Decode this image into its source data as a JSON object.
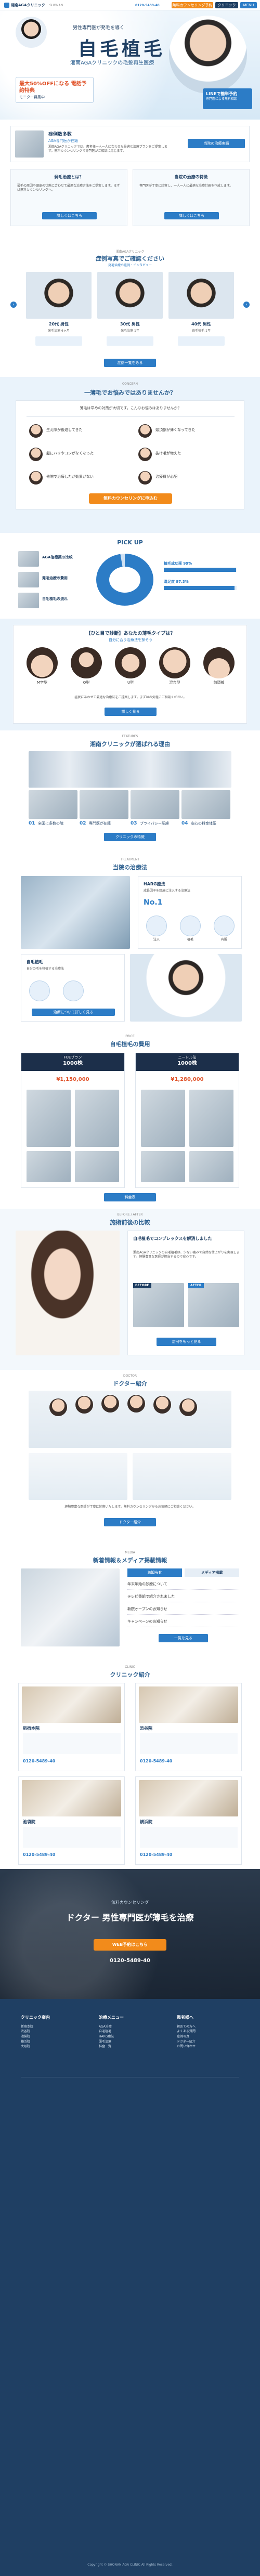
{
  "header": {
    "logo": "湘南AGAクリニック",
    "tag": "SHONAN",
    "tel": "0120-5489-40",
    "reserve": "無料カウンセリング予約",
    "clinic_btn": "クリニック",
    "menu": "MENU"
  },
  "hero": {
    "catch": "男性専門医が発毛を導く",
    "title": "自毛植毛",
    "sub": "湘南AGAクリニックの毛髪再生医療",
    "badge": "最大50%OFFになる 電話予約特典",
    "badge2": "モニター募集中",
    "side_banner": "LINEで簡単予約",
    "side_banner_sub": "専門医による無料相談"
  },
  "intro": {
    "doc_title": "症例数多数",
    "doc_sub": "AGA専門医が在籍",
    "para": "湘南AGAクリニックでは、患者様一人一人に合わせた最適な治療プランをご提案します。無料カウンセリングで専門医がご相談に応じます。",
    "left_btn": "当院の治療実績",
    "link_text": "詳しくはこちら",
    "boxes": [
      {
        "title": "発毛治療とは？",
        "text": "薄毛の原因や頭皮の状態に合わせて最適な治療方法をご提案します。まずは無料カウンセリングへ。"
      },
      {
        "title": "当院の治療の特徴",
        "text": "専門医が丁寧に診察し、一人一人に最適な治療計画を作成します。"
      }
    ]
  },
  "cases": {
    "kicker": "湘南AGAクリニック",
    "title": "症例写真でご確認ください",
    "subtitle": "発毛治療の症例・インタビュー",
    "items": [
      {
        "label": "20代 男性",
        "desc": "発毛治療 6ヶ月"
      },
      {
        "label": "30代 男性",
        "desc": "発毛治療 1年"
      },
      {
        "label": "40代 男性",
        "desc": "自毛植毛 1年"
      }
    ],
    "btn": "症例一覧をみる"
  },
  "concern": {
    "kicker": "CONCERN",
    "title": "一薄毛でお悩みではありませんか？",
    "lead": "薄毛は早めの対策が大切です。こんなお悩みはありませんか？",
    "notes": [
      "生え際が後退してきた",
      "頭頂部が薄くなってきた",
      "髪にハリやコシがなくなった",
      "抜け毛が増えた",
      "他院で治療したが効果がない",
      "治療費が心配"
    ],
    "cta": "無料カウンセリングに申込む"
  },
  "pickup": {
    "title": "PICK UP",
    "items": [
      "AGA治療薬の比較",
      "発毛治療の費用",
      "自毛植毛の流れ"
    ],
    "bars": [
      "植毛成功率 99%",
      "満足度 97.3%"
    ]
  },
  "types": {
    "title": "【ひと目で診断】あなたの薄毛タイプは？",
    "sub": "自分に合う治療法を探そう",
    "labels": [
      "M字型",
      "O型",
      "U型",
      "混合型",
      "前頭部"
    ],
    "note": "症状にあわせて最適な治療法をご提案します。まずはお気軽にご相談ください。",
    "btn": "詳しく見る"
  },
  "features": {
    "kicker": "FEATURES",
    "title": "湘南クリニックが選ばれる理由",
    "items": [
      {
        "n": "01",
        "t": "全国に多数の院"
      },
      {
        "n": "02",
        "t": "専門医が在籍"
      },
      {
        "n": "03",
        "t": "プライバシー配慮"
      },
      {
        "n": "04",
        "t": "安心の料金体系"
      }
    ],
    "btn": "クリニックの特徴"
  },
  "treat": {
    "kicker": "TREATMENT",
    "title": "当院の治療法",
    "boxes": [
      {
        "title": "HARG療法",
        "desc": "成長因子を頭皮に注入する治療法"
      },
      {
        "title": "自毛植毛",
        "desc": "自分の毛を移植する治療法"
      }
    ],
    "num": "No.1",
    "icons": [
      "注入",
      "植毛",
      "内服"
    ],
    "btn": "治療について詳しく見る"
  },
  "price": {
    "kicker": "PRICE",
    "title": "自毛植毛の費用",
    "plans": [
      {
        "name": "FUEプラン",
        "head": "1000株",
        "price": "¥1,150,000"
      },
      {
        "name": "ニードル法",
        "head": "1000株",
        "price": "¥1,280,000"
      }
    ],
    "btn": "料金表"
  },
  "ba": {
    "kicker": "BEFORE / AFTER",
    "title": "施術前後の比較",
    "quote": "自毛植毛でコンプレックスを解消しました",
    "lead": "湘南AGAクリニックの自毛植毛は、少ない痛みで自然な仕上がりを実現します。経験豊富な医師が担当するので安心です。",
    "ba_labels": [
      "BEFORE",
      "AFTER"
    ],
    "btn": "症例をもっと見る"
  },
  "doctors": {
    "kicker": "DOCTOR",
    "title": "ドクター紹介",
    "note": "経験豊富な医師が丁寧に診療いたします。無料カウンセリングからお気軽にご相談ください。",
    "btn": "ドクター紹介"
  },
  "media": {
    "kicker": "MEDIA",
    "title": "新着情報＆メディア掲載情報",
    "tabs": [
      "お知らせ",
      "メディア掲載"
    ],
    "items": [
      "年末年始の診療について",
      "テレビ番組で紹介されました",
      "新院オープンのお知らせ",
      "キャンペーンのお知らせ"
    ],
    "btn": "一覧を見る"
  },
  "clinics": {
    "kicker": "CLINIC",
    "title": "クリニック紹介",
    "list": [
      {
        "name": "新宿本院",
        "tel": "0120-5489-40"
      },
      {
        "name": "渋谷院",
        "tel": "0120-5489-40"
      },
      {
        "name": "池袋院",
        "tel": "0120-5489-40"
      },
      {
        "name": "横浜院",
        "tel": "0120-5489-40"
      }
    ]
  },
  "cta": {
    "kicker": "無料カウンセリング",
    "title": "ドクター 男性専門医が薄毛を治療",
    "btn": "WEB予約はこちら",
    "tel": "0120-5489-40"
  },
  "footer": {
    "cols": [
      {
        "head": "クリニック案内",
        "items": [
          "新宿本院",
          "渋谷院",
          "池袋院",
          "横浜院",
          "大阪院"
        ]
      },
      {
        "head": "治療メニュー",
        "items": [
          "AGA治療",
          "自毛植毛",
          "HARG療法",
          "薄毛治療",
          "料金一覧"
        ]
      },
      {
        "head": "患者様へ",
        "items": [
          "初めての方へ",
          "よくある質問",
          "症例写真",
          "ドクター紹介",
          "お問い合わせ"
        ]
      }
    ],
    "copy": "Copyright © SHONAN AGA CLINIC All Rights Reserved."
  },
  "colors": {
    "primary": "#2c7cc6",
    "navy": "#1f3f63",
    "orange": "#f28b1b",
    "light": "#eaf3fb"
  }
}
